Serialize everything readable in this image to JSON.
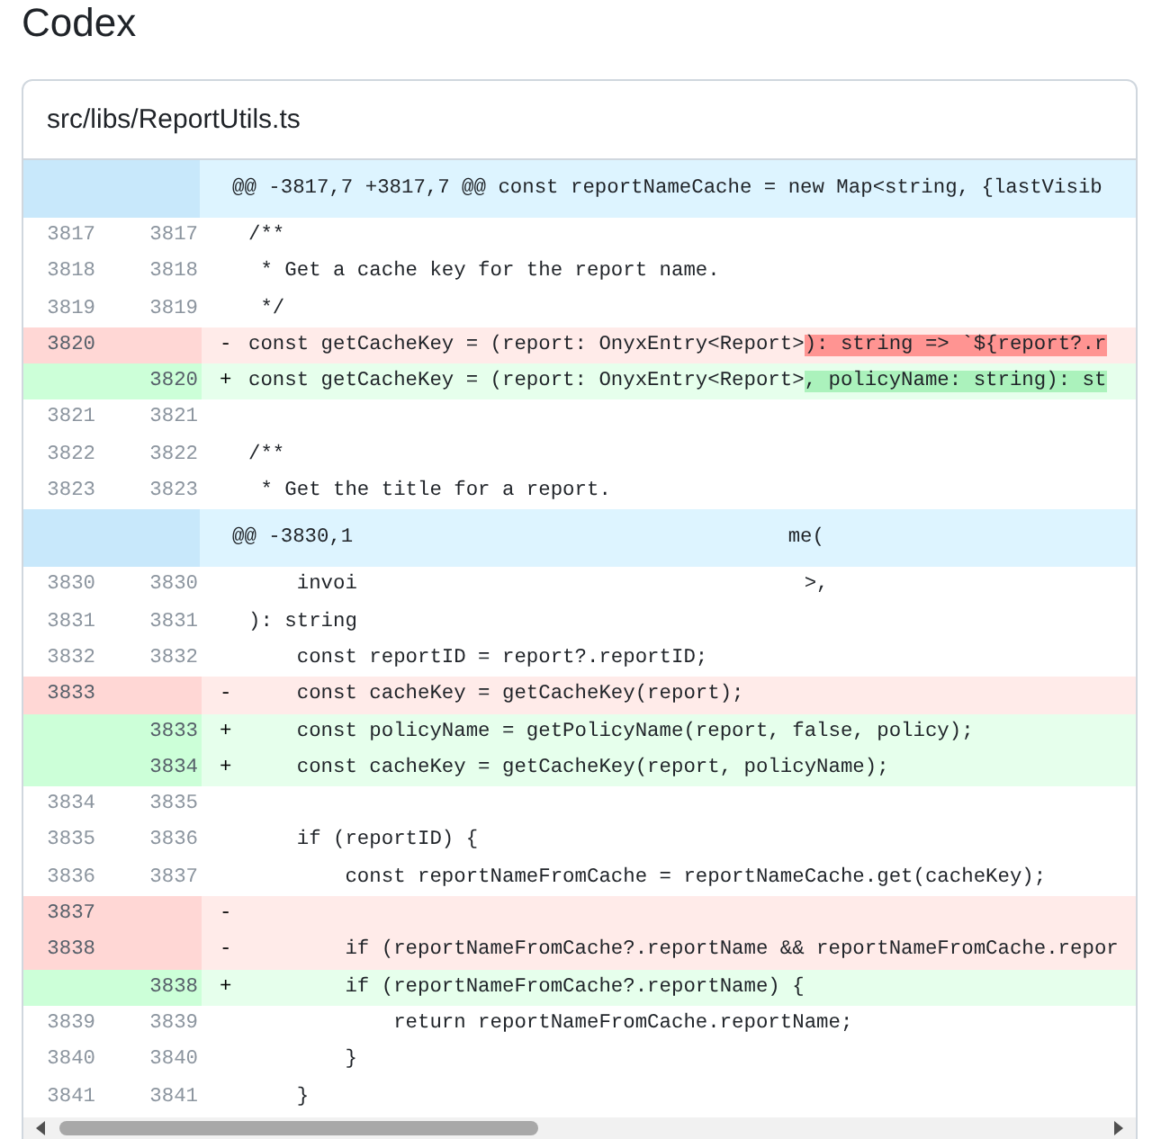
{
  "page_title": "Codex",
  "file": {
    "path": "src/libs/ReportUtils.ts"
  },
  "lines": [
    {
      "kind": "hunk",
      "code": "@@ -3817,7 +3817,7 @@ const reportNameCache = new Map<string, {lastVisib"
    },
    {
      "kind": "context",
      "old": "3817",
      "new": "3817",
      "code": "/**"
    },
    {
      "kind": "context",
      "old": "3818",
      "new": "3818",
      "code": " * Get a cache key for the report name."
    },
    {
      "kind": "context",
      "old": "3819",
      "new": "3819",
      "code": " */"
    },
    {
      "kind": "deletion",
      "old": "3820",
      "sign": "-",
      "code": "const getCacheKey = (report: OnyxEntry<Report>",
      "changed": "): string => `${report?.r"
    },
    {
      "kind": "addition",
      "new": "3820",
      "sign": "+",
      "code": "const getCacheKey = (report: OnyxEntry<Report>",
      "changed": ", policyName: string): st"
    },
    {
      "kind": "context",
      "old": "3821",
      "new": "3821"
    },
    {
      "kind": "context",
      "old": "3822",
      "new": "3822",
      "code": "/**"
    },
    {
      "kind": "context",
      "old": "3823",
      "new": "3823",
      "code": " * Get the title for a report."
    },
    {
      "kind": "hunk",
      "code": "@@ -3830,1",
      "code_after": "me("
    },
    {
      "kind": "context",
      "old": "3830",
      "new": "3830",
      "code": "    invoi",
      "code_after": ">,"
    },
    {
      "kind": "context",
      "old": "3831",
      "new": "3831",
      "code": "): string"
    },
    {
      "kind": "context",
      "old": "3832",
      "new": "3832",
      "code": "    const reportID = report?.reportID;"
    },
    {
      "kind": "deletion",
      "old": "3833",
      "sign": "-",
      "code": "    const cacheKey = getCacheKey(report);"
    },
    {
      "kind": "addition",
      "new": "3833",
      "sign": "+",
      "code": "    const policyName = getPolicyName(report, false, policy);"
    },
    {
      "kind": "addition",
      "new": "3834",
      "sign": "+",
      "code": "    const cacheKey = getCacheKey(report, policyName);"
    },
    {
      "kind": "context",
      "old": "3834",
      "new": "3835"
    },
    {
      "kind": "context",
      "old": "3835",
      "new": "3836",
      "code": "    if (reportID) {"
    },
    {
      "kind": "context",
      "old": "3836",
      "new": "3837",
      "code": "        const reportNameFromCache = reportNameCache.get(cacheKey);"
    },
    {
      "kind": "deletion",
      "old": "3837",
      "sign": "-"
    },
    {
      "kind": "deletion",
      "old": "3838",
      "sign": "-",
      "code": "        if (reportNameFromCache?.reportName && reportNameFromCache.repor"
    },
    {
      "kind": "addition",
      "new": "3838",
      "sign": "+",
      "code": "        if (reportNameFromCache?.reportName) {"
    },
    {
      "kind": "context",
      "old": "3839",
      "new": "3839",
      "code": "            return reportNameFromCache.reportName;"
    },
    {
      "kind": "context",
      "old": "3840",
      "new": "3840",
      "code": "        }"
    },
    {
      "kind": "context",
      "old": "3841",
      "new": "3841",
      "code": "    }"
    }
  ]
}
